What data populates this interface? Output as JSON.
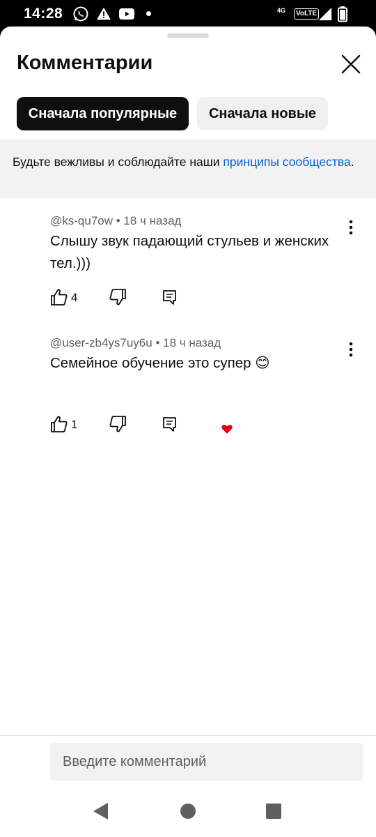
{
  "status_bar": {
    "time": "14:28",
    "network": "4G",
    "volte": "VoLTE",
    "icons": [
      "whatsapp-icon",
      "alert-icon",
      "youtube-icon",
      "notification-dot-icon",
      "signal-icon",
      "battery-icon"
    ]
  },
  "sheet": {
    "title": "Комментарии",
    "sort_chips": [
      {
        "label": "Сначала популярные",
        "selected": true
      },
      {
        "label": "Сначала новые",
        "selected": false
      }
    ],
    "notice": {
      "text": "Будьте вежливы и соблюдайте наши ",
      "link": "принципы сообщества",
      "end": "."
    }
  },
  "comments": [
    {
      "author": "@ks-qu7ow",
      "time": "18 ч назад",
      "text": "Слышу звук падающий стульев и женских тел.)))",
      "likes": "4",
      "creator_heart": false
    },
    {
      "author": "@user-zb4ys7uy6u",
      "time": "18 ч назад",
      "text": "Семейное обучение это супер 😊",
      "likes": "1",
      "creator_heart": true
    }
  ],
  "input": {
    "placeholder": "Введите комментарий"
  },
  "colors": {
    "accent_link": "#065fd4",
    "chip_selected": "#0f0f0f",
    "heart": "#e60012"
  }
}
